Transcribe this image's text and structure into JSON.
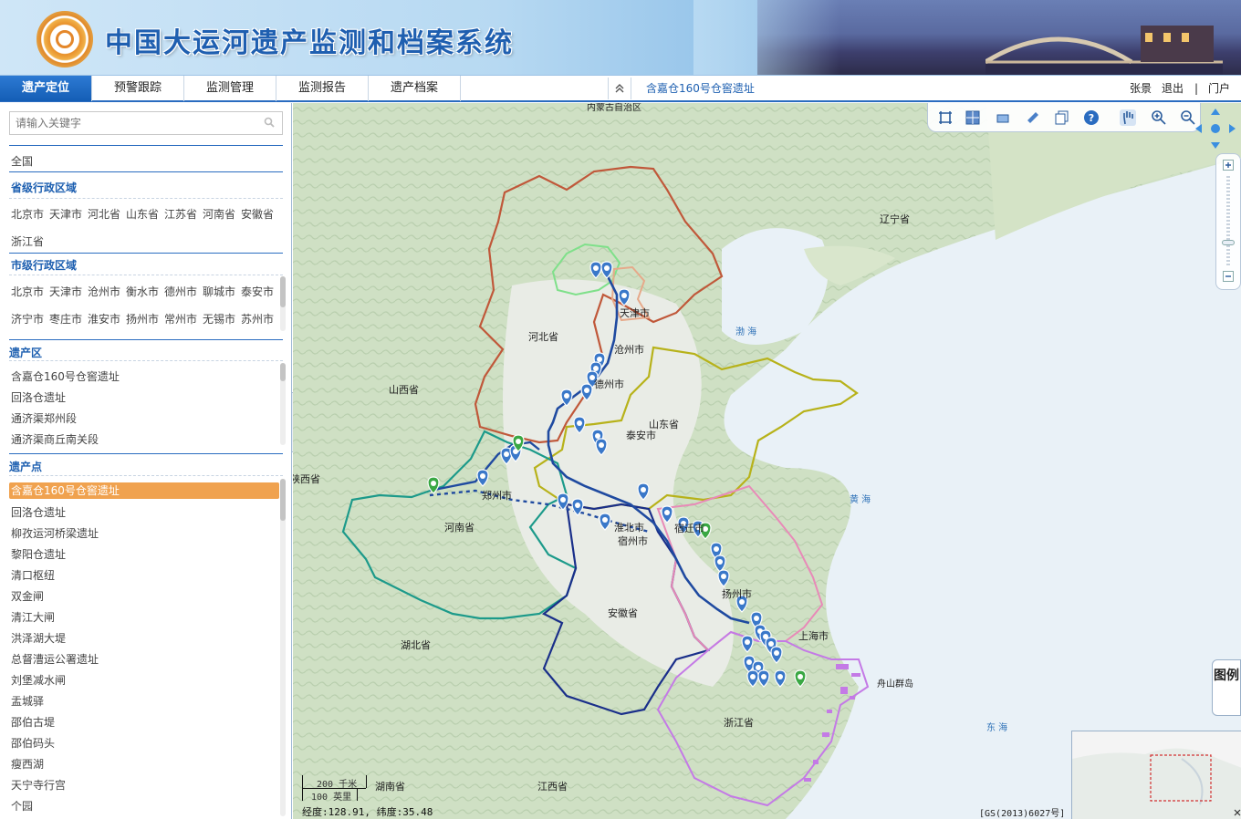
{
  "header": {
    "title": "中国大运河遗产监测和档案系统"
  },
  "nav": {
    "tabs": [
      "遗产定位",
      "预警跟踪",
      "监测管理",
      "监测报告",
      "遗产档案"
    ],
    "current": "含嘉仓160号仓窖遗址",
    "user": "张景",
    "logout": "退出",
    "separator": "|",
    "portal": "门户"
  },
  "sidebar": {
    "search_placeholder": "请输入关键字",
    "all": "全国",
    "province_title": "省级行政区域",
    "provinces_row1": [
      "北京市",
      "天津市",
      "河北省",
      "山东省",
      "江苏省",
      "河南省",
      "安徽省"
    ],
    "provinces_row2": [
      "浙江省"
    ],
    "city_title": "市级行政区域",
    "cities_row1": [
      "北京市",
      "天津市",
      "沧州市",
      "衡水市",
      "德州市",
      "聊城市",
      "泰安市"
    ],
    "cities_row2": [
      "济宁市",
      "枣庄市",
      "淮安市",
      "扬州市",
      "常州市",
      "无锡市",
      "苏州市"
    ],
    "area_title": "遗产区",
    "areas": [
      "含嘉仓160号仓窖遗址",
      "回洛仓遗址",
      "通济渠郑州段",
      "通济渠商丘南关段"
    ],
    "point_title": "遗产点",
    "points": [
      "含嘉仓160号仓窖遗址",
      "回洛仓遗址",
      "柳孜运河桥梁遗址",
      "黎阳仓遗址",
      "清口枢纽",
      "双金闸",
      "清江大闸",
      "洪泽湖大堤",
      "总督漕运公署遗址",
      "刘堡减水闸",
      "盂城驿",
      "邵伯古堤",
      "邵伯码头",
      "瘦西湖",
      "天宁寺行宫",
      "个园"
    ]
  },
  "map": {
    "labels": [
      {
        "text": "河北省"
      },
      {
        "text": "山西省"
      },
      {
        "text": "山东省"
      },
      {
        "text": "河南省"
      },
      {
        "text": "安徽省"
      },
      {
        "text": "湖北省"
      },
      {
        "text": "浙江省"
      },
      {
        "text": "江西省"
      },
      {
        "text": "湖南省"
      },
      {
        "text": "辽宁省"
      },
      {
        "text": "陕西省"
      },
      {
        "text": "天津市"
      },
      {
        "text": "沧州市"
      },
      {
        "text": "德州市"
      },
      {
        "text": "泰安市"
      },
      {
        "text": "郑州市"
      },
      {
        "text": "淮北市"
      },
      {
        "text": "宿州市"
      },
      {
        "text": "宿迁市"
      },
      {
        "text": "扬州市"
      },
      {
        "text": "上海市"
      },
      {
        "text": "舟山群岛"
      },
      {
        "text": "内蒙古自治区"
      }
    ],
    "seas": [
      {
        "text": "渤 海"
      },
      {
        "text": "黄  海"
      },
      {
        "text": "东  海"
      }
    ],
    "scale_km": "200 千米",
    "scale_mi": "100 英里",
    "coords": "经度:128.91, 纬度:35.48",
    "copyright": "[GS(2013)6027号]",
    "legend": "图例",
    "colors": {
      "beijing": "#7fe08a",
      "tianjin": "#e6a98a",
      "hebei": "#c0583a",
      "shandong": "#b7b21a",
      "henan": "#1c9a8a",
      "anhui": "#1a2f8a",
      "jiangsu": "#e88ab8",
      "zhejiang": "#c47ae6",
      "canal": "#1f4aa0",
      "marker": "#3a78c9",
      "marker_green": "#3aa844"
    }
  }
}
